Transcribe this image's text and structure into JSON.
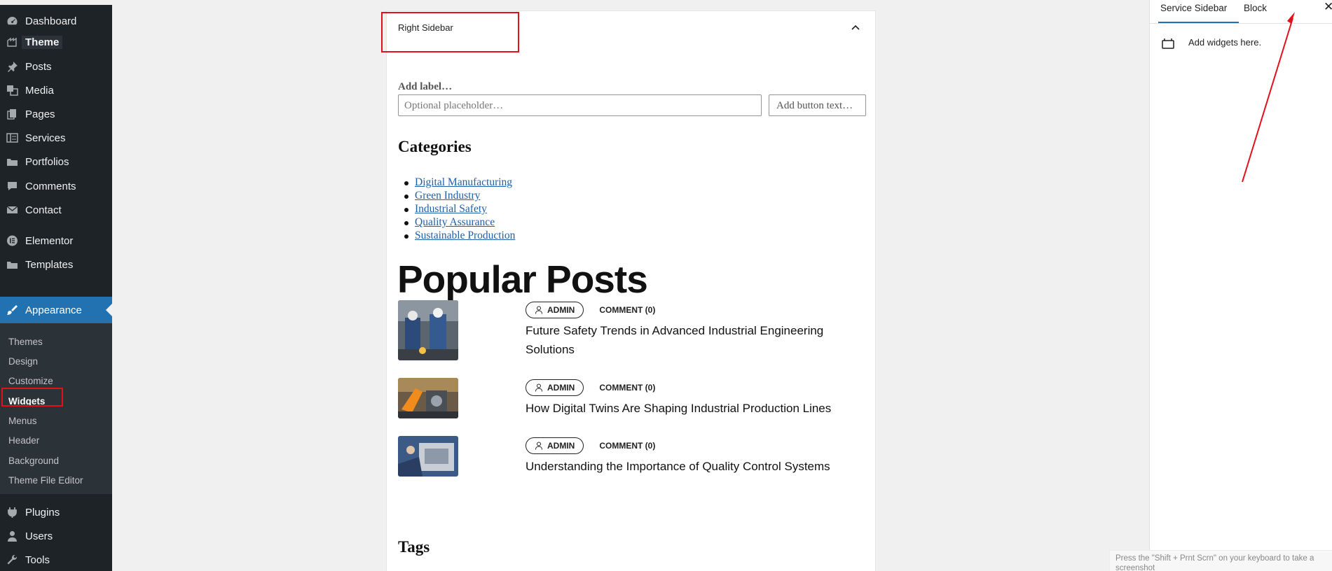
{
  "admin_menu": {
    "items": [
      {
        "label": "Dashboard",
        "icon": "dashboard-icon"
      },
      {
        "label": "Theme",
        "icon": "theme-icon"
      },
      {
        "label": "Posts",
        "icon": "pin-icon"
      },
      {
        "label": "Media",
        "icon": "media-icon"
      },
      {
        "label": "Pages",
        "icon": "pages-icon"
      },
      {
        "label": "Services",
        "icon": "services-icon"
      },
      {
        "label": "Portfolios",
        "icon": "folder-icon"
      },
      {
        "label": "Comments",
        "icon": "comment-icon"
      },
      {
        "label": "Contact",
        "icon": "mail-icon"
      },
      {
        "label": "Elementor",
        "icon": "elementor-icon"
      },
      {
        "label": "Templates",
        "icon": "folder-icon"
      },
      {
        "label": "Appearance",
        "icon": "brush-icon"
      },
      {
        "label": "Plugins",
        "icon": "plugin-icon"
      },
      {
        "label": "Users",
        "icon": "user-icon"
      },
      {
        "label": "Tools",
        "icon": "wrench-icon"
      }
    ],
    "submenu": [
      "Themes",
      "Design",
      "Customize",
      "Widgets",
      "Menus",
      "Header",
      "Background",
      "Theme File Editor"
    ],
    "current_item": "Appearance",
    "current_sub": "Widgets"
  },
  "canvas": {
    "area_title": "Right Sidebar",
    "search": {
      "label": "Add label…",
      "placeholder": "Optional placeholder…",
      "button": "Add button text…"
    },
    "categories_heading": "Categories",
    "categories": [
      "Digital Manufacturing",
      "Green Industry",
      "Industrial Safety",
      "Quality Assurance",
      "Sustainable Production"
    ],
    "popular_heading": "Popular Posts",
    "posts": [
      {
        "author": "ADMIN",
        "comments": "COMMENT (0)",
        "title": "Future Safety Trends in Advanced Industrial Engineering Solutions"
      },
      {
        "author": "ADMIN",
        "comments": "COMMENT (0)",
        "title": "How Digital Twins Are Shaping Industrial Production Lines"
      },
      {
        "author": "ADMIN",
        "comments": "COMMENT (0)",
        "title": "Understanding the Importance of Quality Control Systems"
      }
    ],
    "tags_heading": "Tags"
  },
  "settings_panel": {
    "tabs": [
      "Service Sidebar",
      "Block"
    ],
    "active_tab": "Service Sidebar",
    "close": "✕",
    "description": "Add widgets here."
  },
  "toast": "Press the \"Shift + Prnt Scrn\" on your keyboard to take a screenshot",
  "colors": {
    "admin_bg": "#1d2327",
    "admin_accent": "#2271b1",
    "highlight_red": "#e2101a",
    "link_blue": "#1f5fa6"
  }
}
